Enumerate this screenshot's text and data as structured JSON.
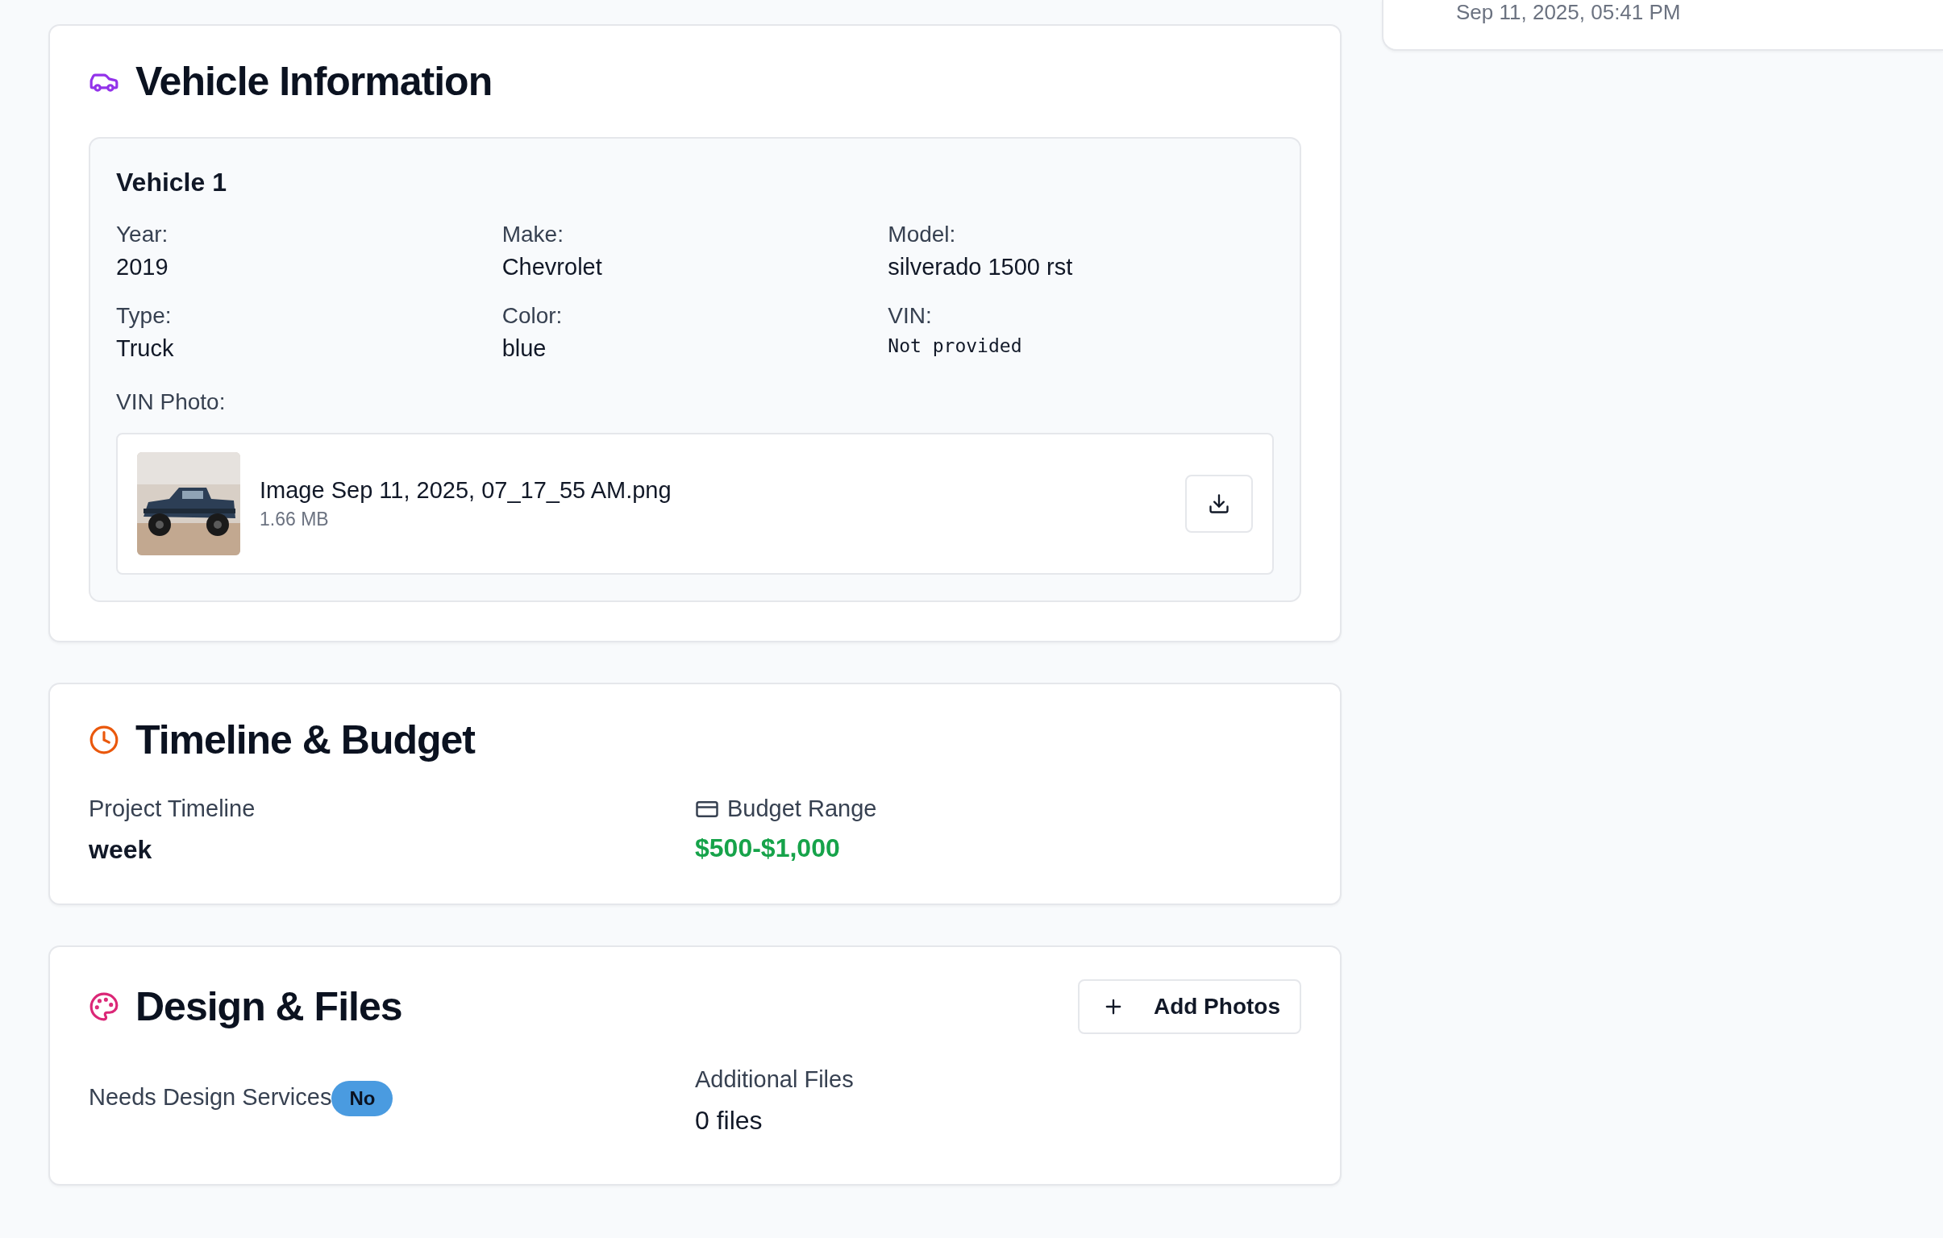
{
  "side_card": {
    "timestamp": "Sep 11, 2025, 05:41 PM"
  },
  "vehicle_information": {
    "title": "Vehicle Information",
    "vehicles": [
      {
        "heading": "Vehicle 1",
        "fields": [
          {
            "label": "Year:",
            "value": "2019",
            "kind": "text"
          },
          {
            "label": "Make:",
            "value": "Chevrolet",
            "kind": "text"
          },
          {
            "label": "Model:",
            "value": "silverado 1500 rst",
            "kind": "text"
          },
          {
            "label": "Type:",
            "value": "Truck",
            "kind": "text"
          },
          {
            "label": "Color:",
            "value": "blue",
            "kind": "text"
          },
          {
            "label": "VIN:",
            "value": "Not provided",
            "kind": "mono"
          }
        ],
        "vin_photo": {
          "label": "VIN Photo:",
          "file_name": "Image Sep 11, 2025, 07_17_55 AM.png",
          "file_size": "1.66 MB"
        }
      }
    ]
  },
  "timeline_budget": {
    "title": "Timeline & Budget",
    "project_timeline": {
      "label": "Project Timeline",
      "value": "week"
    },
    "budget_range": {
      "label": "Budget Range",
      "value": "$500-$1,000"
    }
  },
  "design_files": {
    "title": "Design & Files",
    "add_button": "Add Photos",
    "needs_design": {
      "label": "Needs Design Services",
      "badge": "No"
    },
    "additional_files": {
      "label": "Additional Files",
      "value": "0 files"
    }
  }
}
